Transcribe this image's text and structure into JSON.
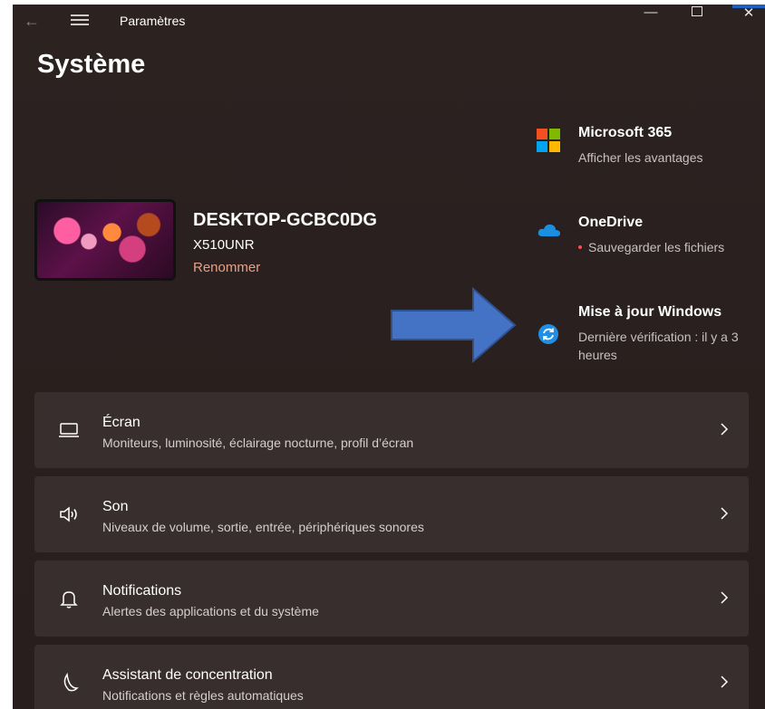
{
  "window": {
    "title": "Paramètres",
    "accent": "#1c5fbe",
    "background": "#2a201f"
  },
  "page": {
    "title": "Système"
  },
  "device": {
    "name": "DESKTOP-GCBC0DG",
    "model": "X510UNR",
    "rename_label": "Renommer",
    "rename_color": "#e8a083"
  },
  "services": [
    {
      "title": "Microsoft 365",
      "subtitle": "Afficher les avantages",
      "icon": "microsoft-logo-icon"
    },
    {
      "title": "OneDrive",
      "subtitle": "Sauvegarder les fichiers",
      "icon": "onedrive-cloud-icon",
      "status_color": "#ff4d4d"
    },
    {
      "title": "Mise à jour Windows",
      "subtitle": "Dernière vérification : il y a 3 heures",
      "icon": "windows-update-icon"
    }
  ],
  "settings": [
    {
      "title": "Écran",
      "subtitle": "Moniteurs, luminosité, éclairage nocturne, profil d’écran",
      "icon": "monitor-icon"
    },
    {
      "title": "Son",
      "subtitle": "Niveaux de volume, sortie, entrée, périphériques sonores",
      "icon": "speaker-icon"
    },
    {
      "title": "Notifications",
      "subtitle": "Alertes des applications et du système",
      "icon": "bell-icon"
    },
    {
      "title": "Assistant de concentration",
      "subtitle": "Notifications et règles automatiques",
      "icon": "moon-icon"
    }
  ],
  "annotation": {
    "icon": "arrow-right-icon",
    "color": "#4472c4"
  }
}
